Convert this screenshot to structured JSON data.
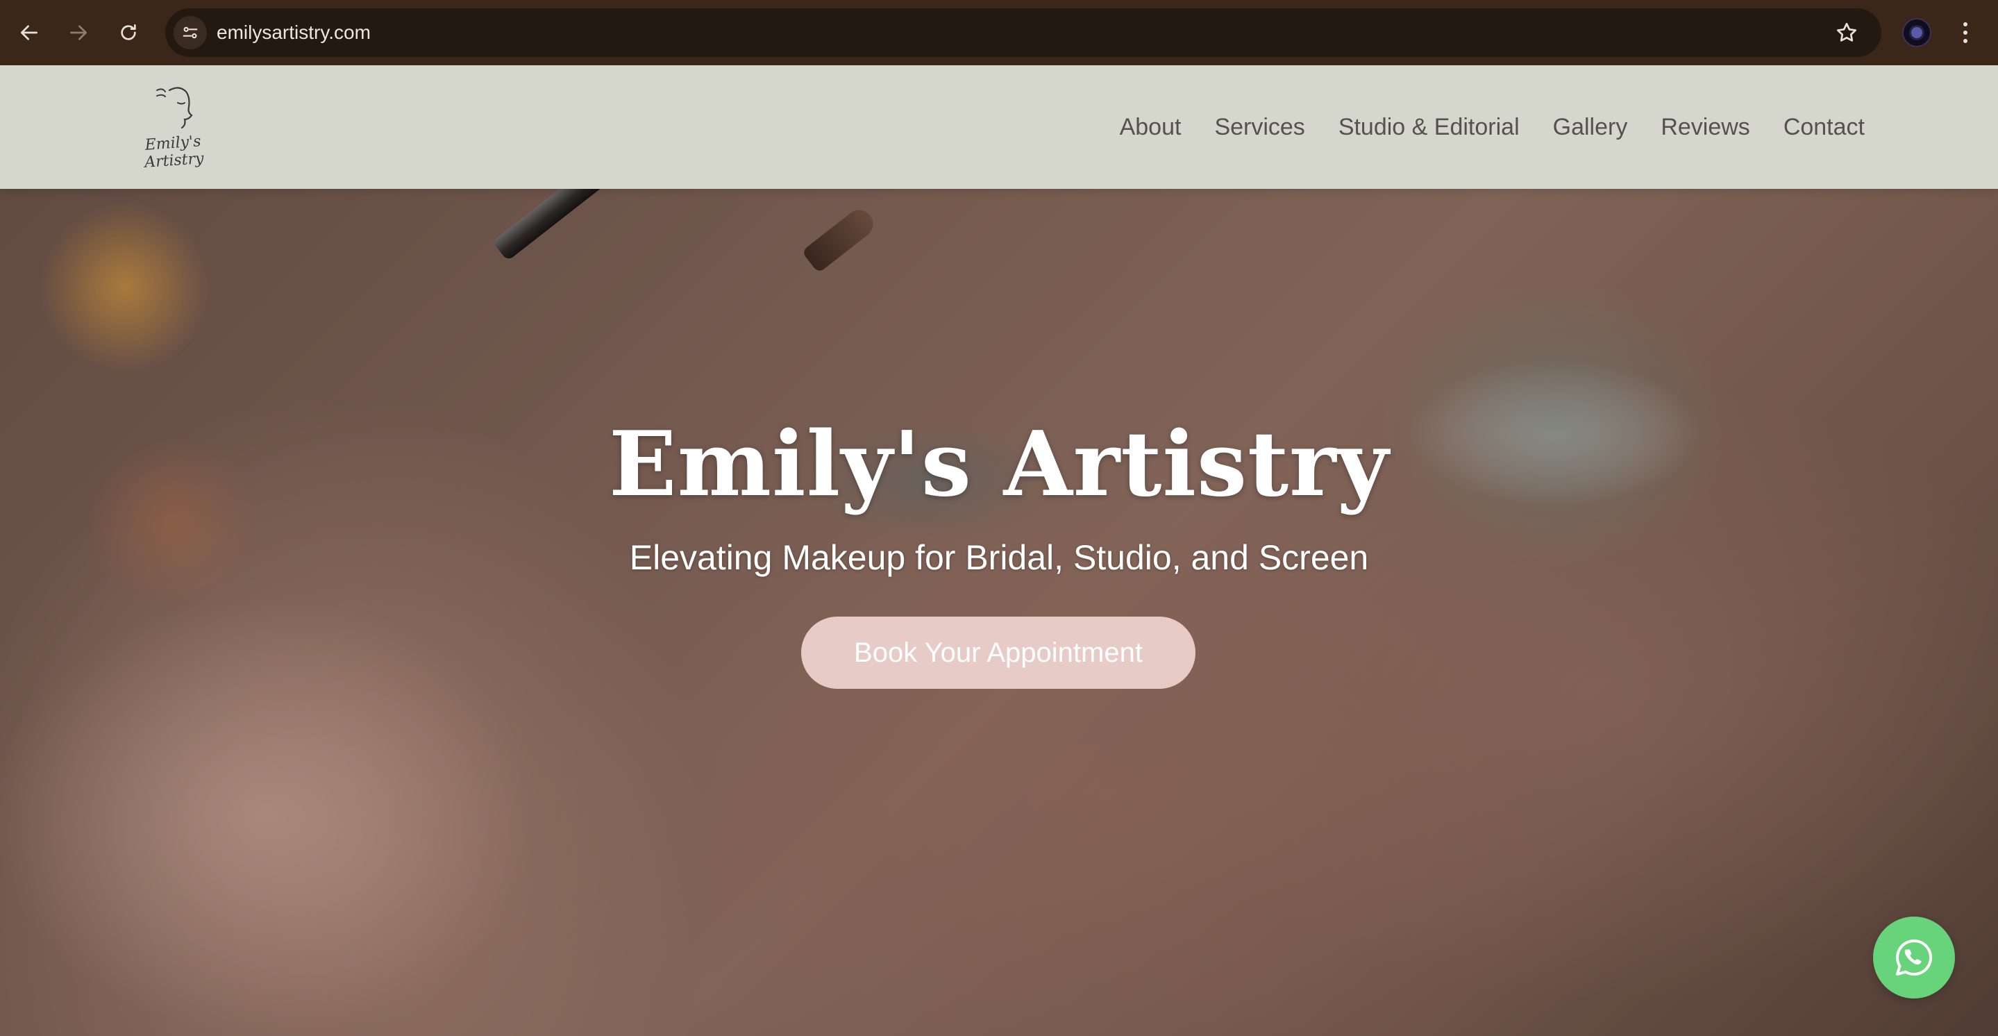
{
  "browser": {
    "url": "emilysartistry.com"
  },
  "site": {
    "logo_text": "Emily's Artistry",
    "nav": [
      {
        "label": "About"
      },
      {
        "label": "Services"
      },
      {
        "label": "Studio & Editorial"
      },
      {
        "label": "Gallery"
      },
      {
        "label": "Reviews"
      },
      {
        "label": "Contact"
      }
    ]
  },
  "hero": {
    "title": "Emily's Artistry",
    "subtitle": "Elevating Makeup for Bridal, Studio, and Screen",
    "cta_label": "Book Your Appointment"
  },
  "colors": {
    "header_bg": "#d5d7cc",
    "cta_bg": "#e7cbc6",
    "whatsapp": "#67d37a",
    "chrome": "#3a271a"
  },
  "icons": [
    "back-arrow-icon",
    "forward-arrow-icon",
    "reload-icon",
    "site-info-icon",
    "bookmark-star-icon",
    "profile-avatar",
    "more-menu-icon",
    "whatsapp-icon"
  ]
}
